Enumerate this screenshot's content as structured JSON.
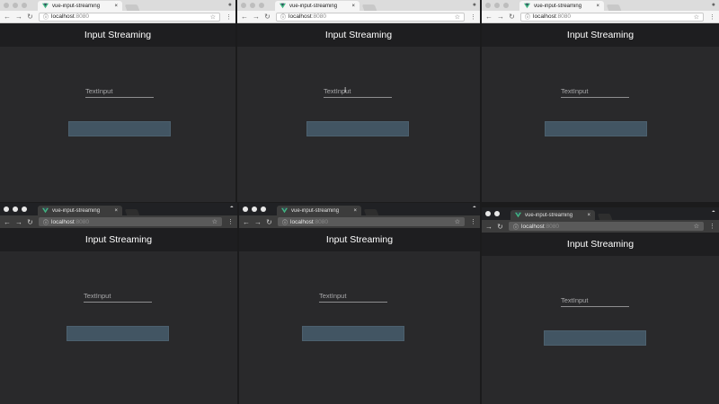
{
  "windows": [
    {
      "id": "w1",
      "theme": "light",
      "tab_title": "vue-input-streaming",
      "close": "×",
      "url_host": "localhost",
      "url_port": ":8080",
      "app_title": "Input Streaming",
      "input_placeholder": "TextInput"
    },
    {
      "id": "w2",
      "theme": "light",
      "tab_title": "vue-input-streaming",
      "close": "×",
      "url_host": "localhost",
      "url_port": ":8080",
      "app_title": "Input Streaming",
      "input_placeholder": "TextInput"
    },
    {
      "id": "w3",
      "theme": "light",
      "tab_title": "vue-input-streaming",
      "close": "×",
      "url_host": "localhost",
      "url_port": ":8080",
      "app_title": "Input Streaming",
      "input_placeholder": "TextInput"
    },
    {
      "id": "w4",
      "theme": "dark",
      "tab_title": "vue-input-streaming",
      "close": "×",
      "url_host": "localhost",
      "url_port": ":8080",
      "app_title": "Input Streaming",
      "input_placeholder": "TextInput"
    },
    {
      "id": "w5",
      "theme": "dark",
      "tab_title": "vue-input-streaming",
      "close": "×",
      "url_host": "localhost",
      "url_port": ":8080",
      "app_title": "Input Streaming",
      "input_placeholder": "TextInput"
    },
    {
      "id": "w6",
      "theme": "dark",
      "tab_title": "vue-input-streaming",
      "close": "×",
      "url_host": "localhost",
      "url_port": ":8080",
      "app_title": "Input Streaming",
      "input_placeholder": "TextInput"
    }
  ],
  "colors": {
    "app_background": "#29292b",
    "app_header": "#1e1e20",
    "stream_bar": "#425563",
    "vue_green": "#41b883",
    "vue_dark": "#35495e"
  },
  "icons": [
    "vue-logo-icon",
    "back-arrow-icon",
    "forward-arrow-icon",
    "reload-icon",
    "info-icon",
    "star-icon",
    "menu-dots-icon",
    "profile-icon",
    "incognito-icon",
    "cursor-icon"
  ]
}
